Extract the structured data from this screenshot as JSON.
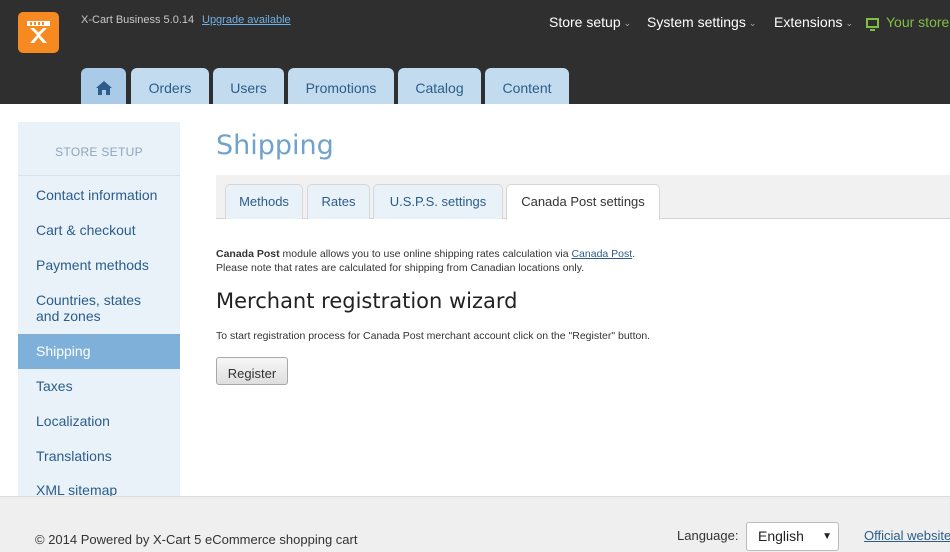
{
  "header": {
    "logo_icon": "xcart-logo-icon",
    "version": "X-Cart Business 5.0.14",
    "upgrade_link": "Upgrade available",
    "nav": [
      {
        "label": "Store setup"
      },
      {
        "label": "System settings"
      },
      {
        "label": "Extensions"
      }
    ],
    "your_store": "Your store",
    "accent_color": "#7fc044"
  },
  "main_tabs": [
    {
      "label": "",
      "icon": "home-icon"
    },
    {
      "label": "Orders"
    },
    {
      "label": "Users"
    },
    {
      "label": "Promotions"
    },
    {
      "label": "Catalog"
    },
    {
      "label": "Content"
    }
  ],
  "sidebar": {
    "heading": "STORE SETUP",
    "items": [
      {
        "label": "Contact information"
      },
      {
        "label": "Cart & checkout"
      },
      {
        "label": "Payment methods"
      },
      {
        "label": "Countries, states and zones"
      },
      {
        "label": "Shipping",
        "active": true
      },
      {
        "label": "Taxes"
      },
      {
        "label": "Localization"
      },
      {
        "label": "Translations"
      },
      {
        "label": "XML sitemap"
      }
    ]
  },
  "main": {
    "title": "Shipping",
    "tabs": [
      {
        "label": "Methods"
      },
      {
        "label": "Rates"
      },
      {
        "label": "U.S.P.S. settings"
      },
      {
        "label": "Canada Post settings",
        "active": true
      }
    ],
    "desc_bold": "Canada Post",
    "desc_text": "module allows you to use online shipping rates calculation via",
    "desc_link": "Canada Post",
    "desc_period": ".",
    "desc_line2": "Please note that rates are calculated for shipping from Canadian locations only.",
    "wizard_title": "Merchant registration wizard",
    "register_text": "To start registration process for Canada Post merchant account click on the \"Register\" button.",
    "register_button": "Register"
  },
  "footer": {
    "copyright": "© 2014 Powered by X-Cart 5 eCommerce shopping cart",
    "language_label": "Language:",
    "language_value": "English",
    "official_link": "Official website"
  }
}
